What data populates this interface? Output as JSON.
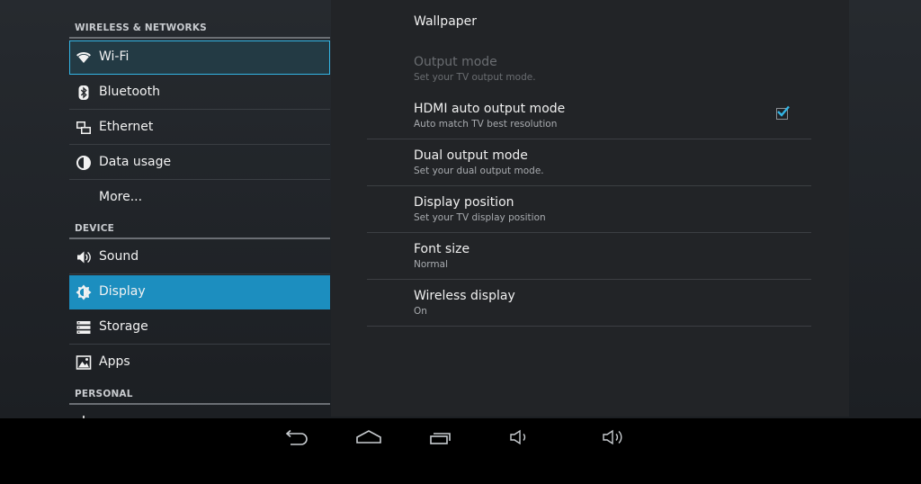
{
  "sidebar": {
    "sections": [
      {
        "label": "WIRELESS & NETWORKS"
      },
      {
        "label": "DEVICE"
      },
      {
        "label": "PERSONAL"
      }
    ],
    "items": [
      {
        "label": "Wi-Fi",
        "icon": "wifi-icon"
      },
      {
        "label": "Bluetooth",
        "icon": "bluetooth-icon"
      },
      {
        "label": "Ethernet",
        "icon": "ethernet-icon"
      },
      {
        "label": "Data usage",
        "icon": "data-usage-icon"
      },
      {
        "label": "More...",
        "icon": ""
      },
      {
        "label": "Sound",
        "icon": "speaker-icon"
      },
      {
        "label": "Display",
        "icon": "brightness-icon"
      },
      {
        "label": "Storage",
        "icon": "storage-icon"
      },
      {
        "label": "Apps",
        "icon": "apps-icon"
      }
    ],
    "focused_item": "Wi-Fi",
    "selected_item": "Display"
  },
  "display_settings": {
    "wallpaper": {
      "title": "Wallpaper"
    },
    "output_mode": {
      "title": "Output mode",
      "summary": "Set your TV output mode.",
      "enabled": false
    },
    "hdmi_auto": {
      "title": "HDMI auto output mode",
      "summary": "Auto match TV best resolution",
      "checked": true
    },
    "dual_output": {
      "title": "Dual output mode",
      "summary": "Set your dual output mode."
    },
    "display_position": {
      "title": "Display position",
      "summary": "Set your TV display position"
    },
    "font_size": {
      "title": "Font size",
      "summary": "Normal"
    },
    "wireless_display": {
      "title": "Wireless display",
      "summary": "On"
    }
  },
  "navbar": {
    "buttons": [
      "back-icon",
      "home-icon",
      "recent-apps-icon",
      "volume-down-icon",
      "volume-up-icon"
    ]
  },
  "colors": {
    "accent": "#33b5e5",
    "selected_bg": "#1c8ebf"
  }
}
